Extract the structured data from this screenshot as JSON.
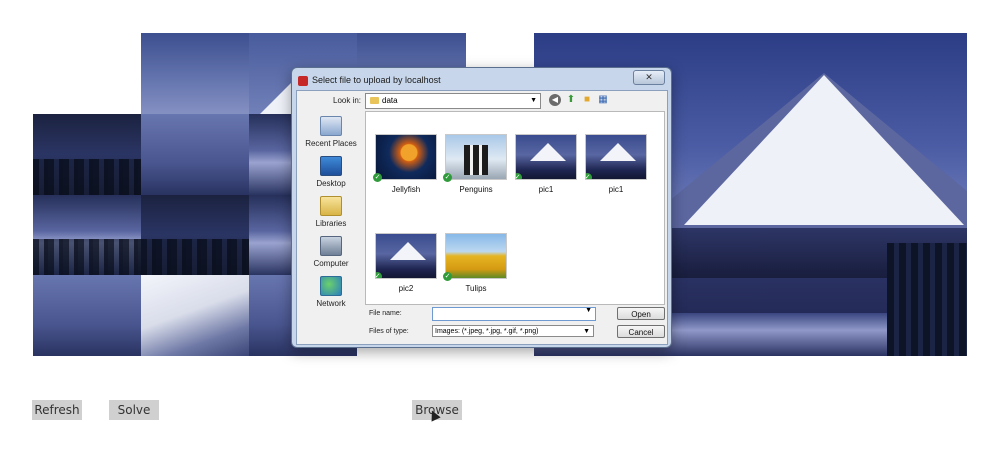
{
  "dialog": {
    "title": "Select file to upload by localhost",
    "close_symbol": "✕",
    "look_in_label": "Look in:",
    "look_in_value": "data",
    "places": [
      {
        "label": "Recent Places",
        "icon": "recent-places-icon"
      },
      {
        "label": "Desktop",
        "icon": "desktop-icon"
      },
      {
        "label": "Libraries",
        "icon": "libraries-icon"
      },
      {
        "label": "Computer",
        "icon": "computer-icon"
      },
      {
        "label": "Network",
        "icon": "network-icon"
      }
    ],
    "files": [
      {
        "name": "Jellyfish"
      },
      {
        "name": "Penguins"
      },
      {
        "name": "pic1"
      },
      {
        "name": "pic1"
      },
      {
        "name": "pic2"
      },
      {
        "name": "Tulips"
      }
    ],
    "file_name_label": "File name:",
    "file_name_value": "",
    "files_of_type_label": "Files of type:",
    "files_of_type_value": "Images: (*.jpeg, *.jpg, *.gif, *.png)",
    "open_label": "Open",
    "cancel_label": "Cancel"
  },
  "controls": {
    "refresh_label": "Refresh",
    "solve_label": "Solve",
    "browse_label": "Browse"
  }
}
